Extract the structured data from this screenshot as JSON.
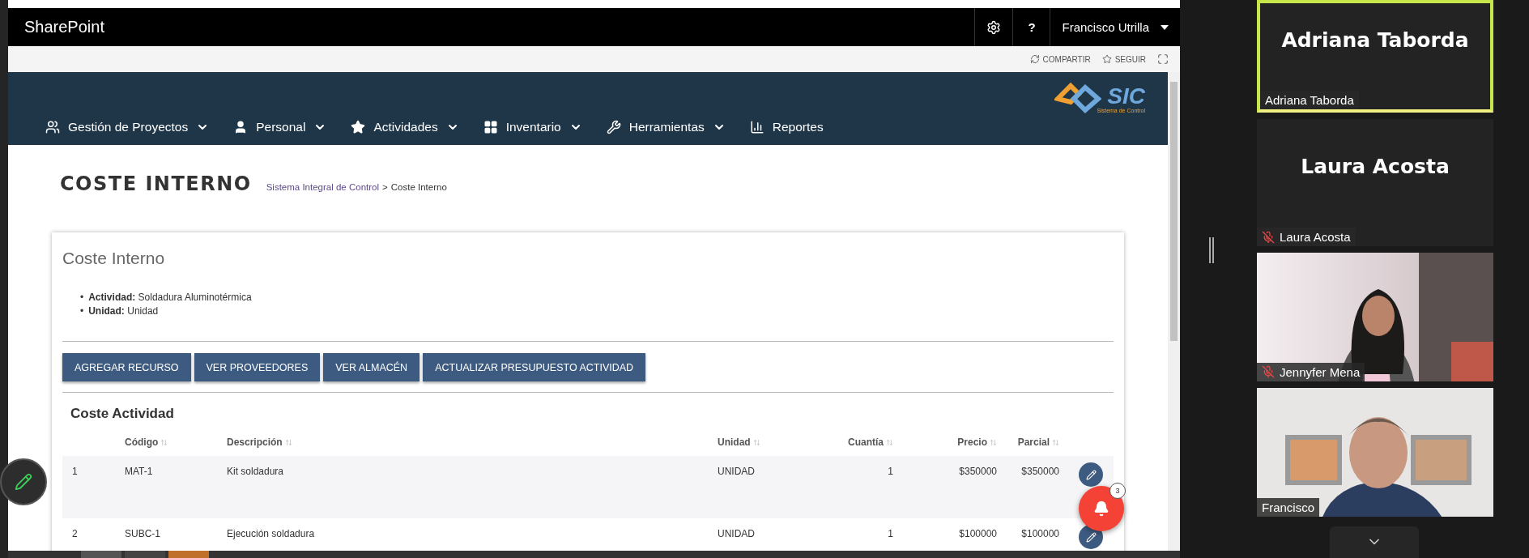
{
  "suite_bar": {
    "brand": "SharePoint",
    "help": "?",
    "user": "Francisco Utrilla"
  },
  "ribbon": {
    "actions": [
      {
        "label": "COMPARTIR",
        "kind": "share"
      },
      {
        "label": "SEGUIR",
        "kind": "follow"
      }
    ]
  },
  "nav": {
    "items": [
      {
        "label": "Gestión de Proyectos",
        "kind": "team",
        "has_menu": true
      },
      {
        "label": "Personal",
        "kind": "person",
        "has_menu": true
      },
      {
        "label": "Actividades",
        "kind": "star",
        "has_menu": true
      },
      {
        "label": "Inventario",
        "kind": "grid",
        "has_menu": true
      },
      {
        "label": "Herramientas",
        "kind": "tools",
        "has_menu": true
      },
      {
        "label": "Reportes",
        "kind": "chart",
        "has_menu": false
      }
    ],
    "logo": {
      "mark": "SIC",
      "tagline": "Sistema de Control"
    }
  },
  "page": {
    "title": "COSTE INTERNO",
    "breadcrumb": [
      {
        "label": "Sistema Integral de Control",
        "link": true
      },
      {
        "label": "Coste Interno",
        "link": false
      }
    ],
    "breadcrumb_separator": ">"
  },
  "card": {
    "title": "Coste Interno",
    "detail_bullet": "•",
    "details": [
      "**Actividad:** Soldadura Aluminotérmica",
      "**Unidad:** Unidad"
    ],
    "buttons": [
      "AGREGAR RECURSO",
      "VER PROVEEDORES",
      "VER ALMACÉN",
      "ACTUALIZAR PRESUPUESTO ACTIVIDAD"
    ],
    "section_title": "Coste Actividad",
    "table": {
      "columns": [
        {},
        {
          "label": "Código",
          "sortable": true
        },
        {
          "label": "Descripción",
          "sortable": true
        },
        {
          "label": "Unidad",
          "sortable": true
        },
        {
          "label": "Cuantía",
          "sortable": true
        },
        {
          "label": "Precio",
          "sortable": true
        },
        {
          "label": "Parcial",
          "sortable": true
        }
      ],
      "rows": [
        [
          "1",
          "MAT-1",
          "Kit soldadura",
          "UNIDAD",
          "1",
          "$350000",
          "$350000"
        ],
        [
          "2",
          "SUBC-1",
          "Ejecución soldadura",
          "UNIDAD",
          "1",
          "$100000",
          "$100000"
        ]
      ]
    }
  },
  "notifications": {
    "count": "3"
  },
  "participants": [
    {
      "kind": "name",
      "display_name": "Adriana Taborda",
      "label": "Adriana Taborda",
      "muted": false,
      "speaking": true
    },
    {
      "kind": "name",
      "display_name": "Laura Acosta",
      "label": "Laura Acosta",
      "muted": true,
      "speaking": false
    },
    {
      "kind": "picture",
      "label": "Jennyfer Mena",
      "muted": true,
      "speaking": false
    },
    {
      "kind": "picture",
      "label": "Francisco",
      "muted": false,
      "speaking": false
    }
  ]
}
